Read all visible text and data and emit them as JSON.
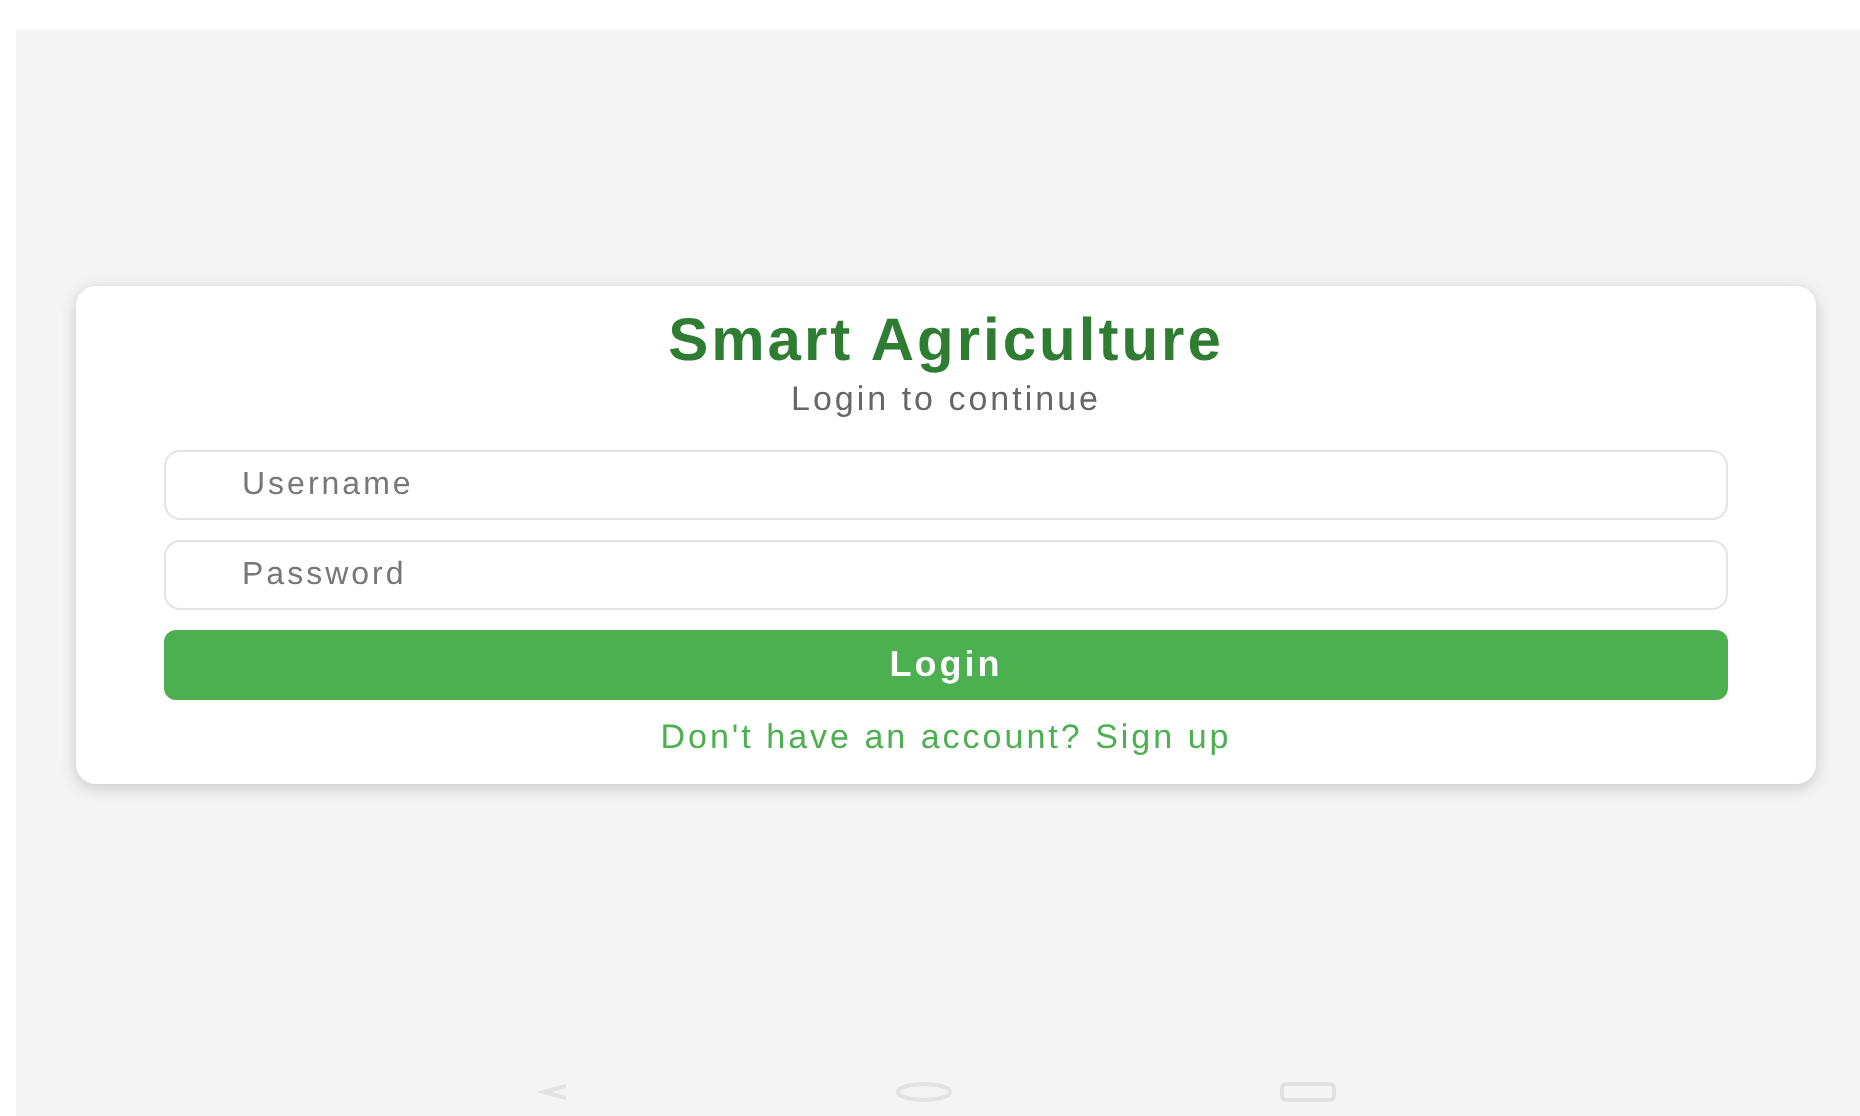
{
  "login_card": {
    "title": "Smart Agriculture",
    "subtitle": "Login to continue",
    "fields": [
      {
        "placeholder": "Username"
      },
      {
        "placeholder": "Password"
      }
    ],
    "login_button": "Login",
    "signup_link": "Don't have an account? Sign up"
  }
}
